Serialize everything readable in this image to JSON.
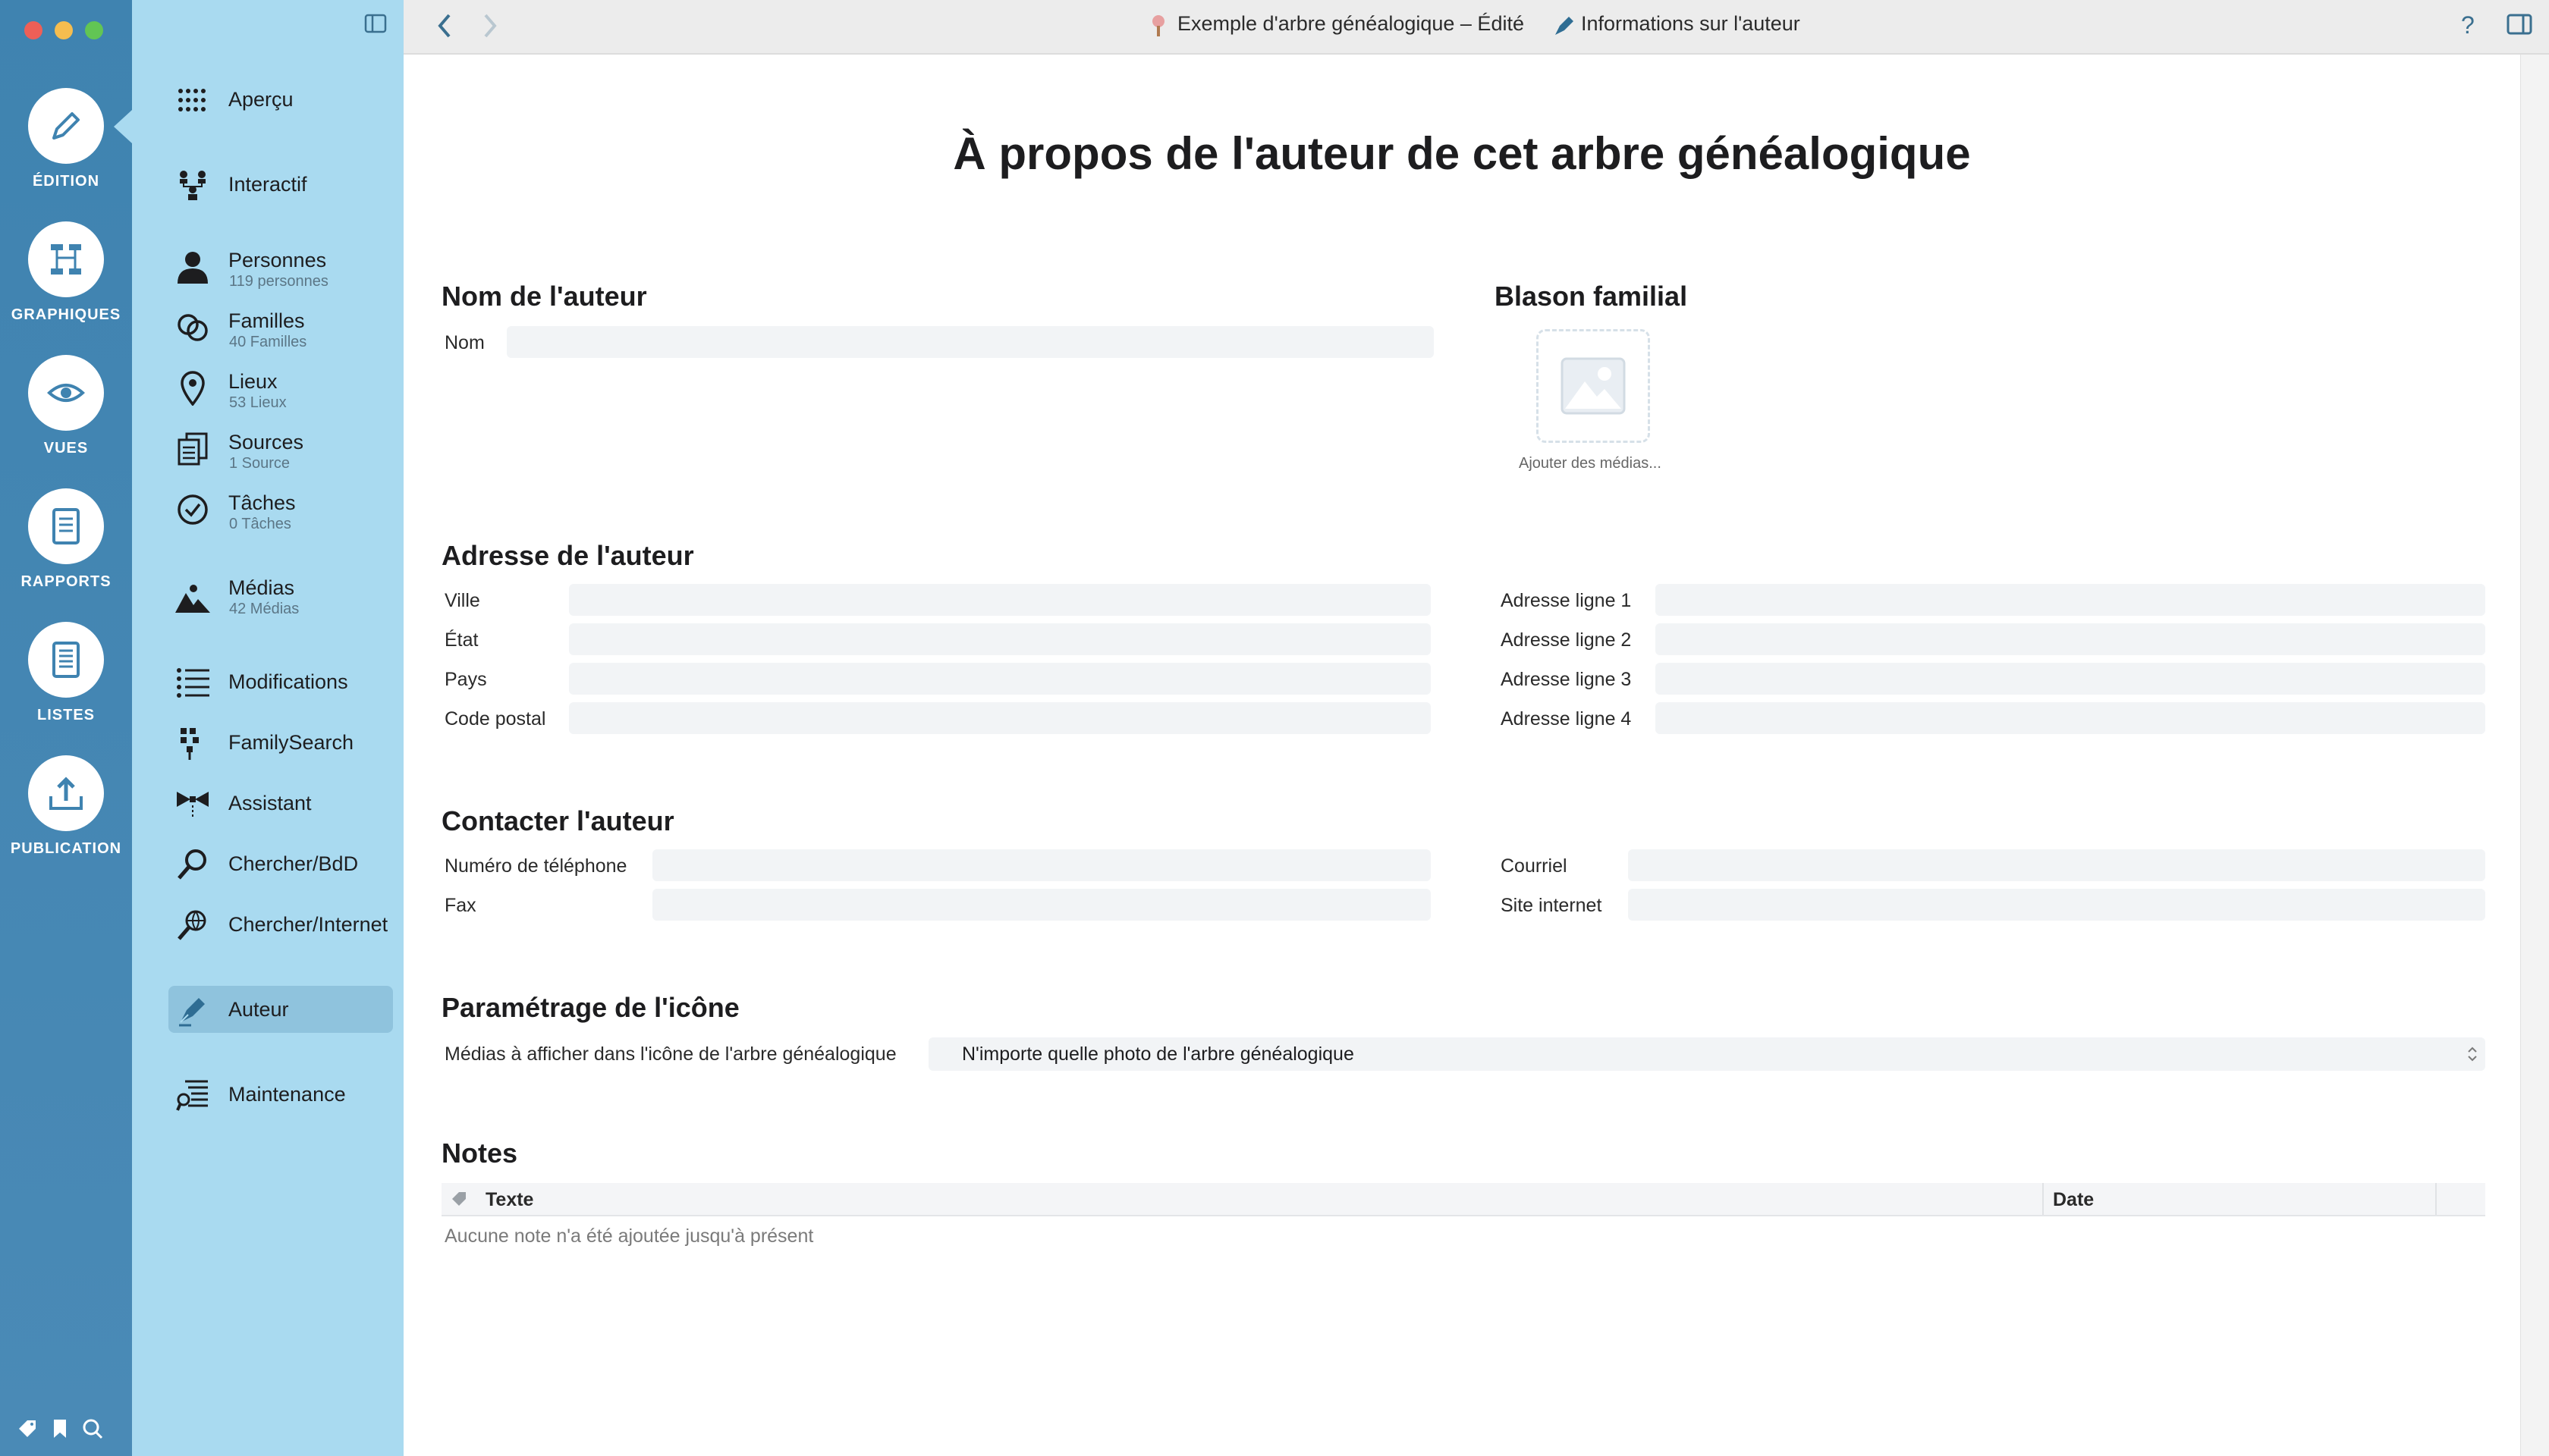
{
  "window": {
    "title": "Exemple d'arbre généalogique – Édité",
    "subtitle": "Informations sur l'auteur"
  },
  "rail": {
    "items": [
      {
        "label": "ÉDITION",
        "icon": "pencil-icon"
      },
      {
        "label": "GRAPHIQUES",
        "icon": "chart-tree-icon"
      },
      {
        "label": "VUES",
        "icon": "eye-icon"
      },
      {
        "label": "RAPPORTS",
        "icon": "report-icon"
      },
      {
        "label": "LISTES",
        "icon": "list-doc-icon"
      },
      {
        "label": "PUBLICATION",
        "icon": "upload-icon"
      }
    ]
  },
  "sidebar": {
    "items": [
      {
        "label": "Aperçu",
        "sub": ""
      },
      {
        "label": "Interactif",
        "sub": ""
      },
      {
        "label": "Personnes",
        "sub": "119 personnes"
      },
      {
        "label": "Familles",
        "sub": "40 Familles"
      },
      {
        "label": "Lieux",
        "sub": "53 Lieux"
      },
      {
        "label": "Sources",
        "sub": "1 Source"
      },
      {
        "label": "Tâches",
        "sub": "0 Tâches"
      },
      {
        "label": "Médias",
        "sub": "42 Médias"
      },
      {
        "label": "Modifications",
        "sub": ""
      },
      {
        "label": "FamilySearch",
        "sub": ""
      },
      {
        "label": "Assistant",
        "sub": ""
      },
      {
        "label": "Chercher/BdD",
        "sub": ""
      },
      {
        "label": "Chercher/Internet",
        "sub": ""
      },
      {
        "label": "Auteur",
        "sub": ""
      },
      {
        "label": "Maintenance",
        "sub": ""
      }
    ],
    "selected": "Auteur"
  },
  "page": {
    "title": "À propos de l'auteur de cet arbre généalogique",
    "name_section": {
      "heading": "Nom de l'auteur",
      "name_label": "Nom",
      "name_value": ""
    },
    "crest_section": {
      "heading": "Blason familial",
      "add_media": "Ajouter des médias..."
    },
    "address_section": {
      "heading": "Adresse de l'auteur",
      "left": [
        {
          "label": "Ville",
          "value": ""
        },
        {
          "label": "État",
          "value": ""
        },
        {
          "label": "Pays",
          "value": ""
        },
        {
          "label": "Code postal",
          "value": ""
        }
      ],
      "right": [
        {
          "label": "Adresse ligne 1",
          "value": ""
        },
        {
          "label": "Adresse ligne 2",
          "value": ""
        },
        {
          "label": "Adresse ligne 3",
          "value": ""
        },
        {
          "label": "Adresse ligne 4",
          "value": ""
        }
      ]
    },
    "contact_section": {
      "heading": "Contacter l'auteur",
      "left": [
        {
          "label": "Numéro de téléphone",
          "value": ""
        },
        {
          "label": "Fax",
          "value": ""
        }
      ],
      "right": [
        {
          "label": "Courriel",
          "value": ""
        },
        {
          "label": "Site internet",
          "value": ""
        }
      ]
    },
    "icon_section": {
      "heading": "Paramétrage de l'icône",
      "label": "Médias à afficher dans l'icône de l'arbre généalogique",
      "selected": "N'importe quelle photo de l'arbre généalogique"
    },
    "notes_section": {
      "heading": "Notes",
      "columns": [
        "Texte",
        "Date"
      ],
      "empty": "Aucune note n'a été ajoutée jusqu'à présent"
    }
  },
  "colors": {
    "rail": "#4a8ab6",
    "sidebar": "#a9daf0",
    "selected": "#8fc3dd",
    "field": "#f2f4f6"
  }
}
